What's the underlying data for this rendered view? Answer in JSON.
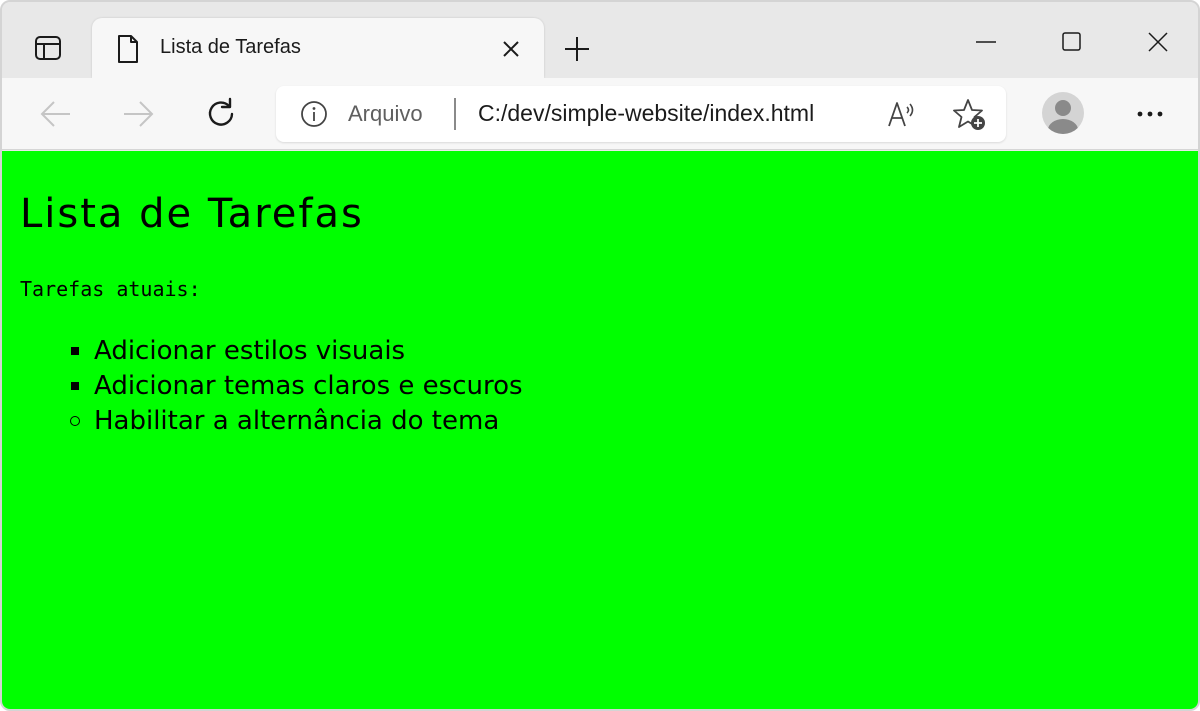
{
  "browser": {
    "tab": {
      "title": "Lista de Tarefas"
    },
    "address_bar": {
      "scheme_label": "Arquivo",
      "url": "C:/dev/simple-website/index.html"
    },
    "icons": {
      "tab_actions": "tab-actions-icon",
      "tab_page": "document-icon",
      "tab_close": "close-icon",
      "new_tab": "plus-icon",
      "minimize": "minimize-icon",
      "maximize": "maximize-icon",
      "close_window": "close-icon",
      "back": "arrow-left-icon",
      "forward": "arrow-right-icon",
      "reload": "reload-icon",
      "site_info": "info-icon",
      "read_aloud": "read-aloud-icon",
      "add_favorite": "star-add-icon",
      "profile": "avatar-icon",
      "menu": "more-icon"
    }
  },
  "page": {
    "background_color": "#00ff00",
    "heading": "Lista de Tarefas",
    "subtitle": "Tarefas atuais:",
    "tasks": [
      {
        "label": "Adicionar estilos visuais",
        "bullet": "square"
      },
      {
        "label": "Adicionar temas claros e escuros",
        "bullet": "square"
      },
      {
        "label": "Habilitar a alternância do tema",
        "bullet": "circle"
      }
    ]
  }
}
